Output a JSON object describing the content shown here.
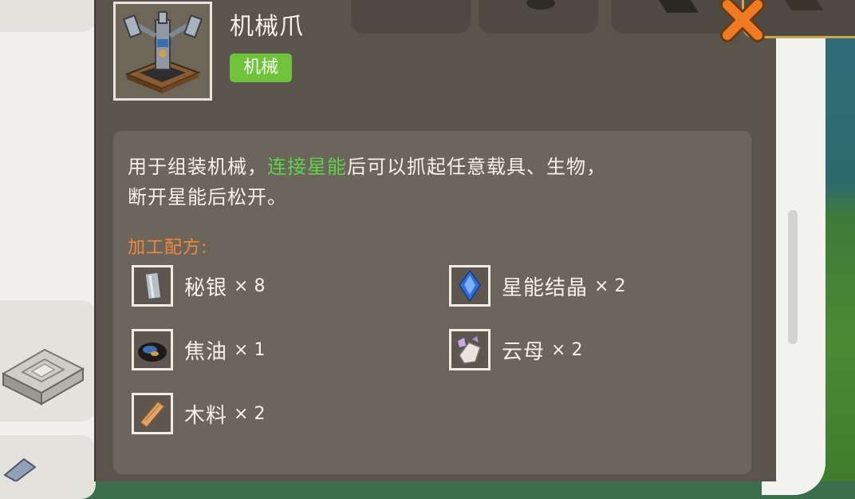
{
  "item": {
    "title": "机械爪",
    "tag": "机械",
    "icon": "mechanical-claw-icon"
  },
  "description": {
    "before": "用于组装机械，",
    "highlight": "连接星能",
    "after_line1": "后可以抓起任意载具、生物，",
    "line2": "断开星能后松开。"
  },
  "recipe": {
    "title": "加工配方:",
    "ingredients": [
      {
        "name": "秘银",
        "qty": "× 8",
        "icon": "mithril-icon"
      },
      {
        "name": "星能结晶",
        "qty": "× 2",
        "icon": "star-crystal-icon"
      },
      {
        "name": "焦油",
        "qty": "× 1",
        "icon": "tar-icon"
      },
      {
        "name": "云母",
        "qty": "× 2",
        "icon": "mica-icon"
      },
      {
        "name": "木料",
        "qty": "× 2",
        "icon": "wood-icon"
      }
    ]
  },
  "colors": {
    "panel": "#5a544c",
    "tag": "#70c43c",
    "highlight": "#5fd14a",
    "recipe_title": "#f0883a",
    "close": "#f07a22"
  }
}
